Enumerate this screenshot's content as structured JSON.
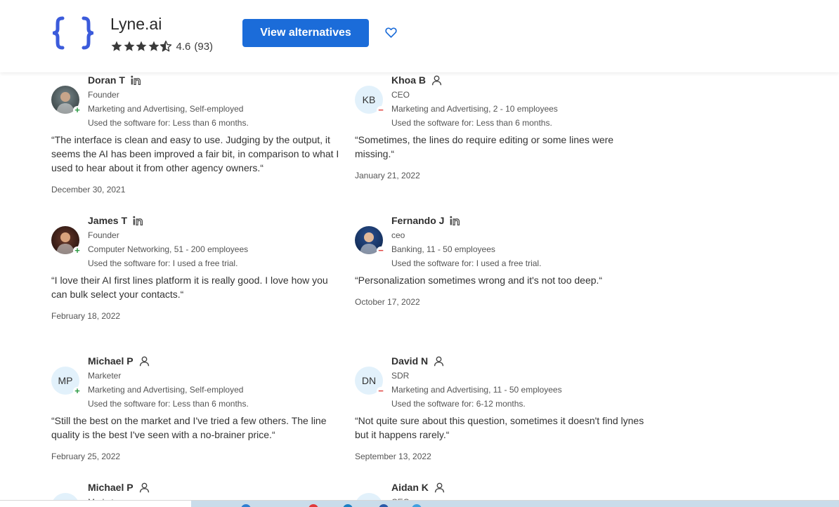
{
  "header": {
    "logo_icon": "curly-braces-logo-icon",
    "logo_color": "#3b5bdb",
    "product_name": "Lyne.ai",
    "rating": {
      "stars": 4.5,
      "score": "4.6",
      "count": "(93)"
    },
    "cta_label": "View alternatives",
    "cta_color": "#1b6cd9",
    "favorite_icon": "heart-icon"
  },
  "reviews": [
    {
      "name": "Doran T",
      "source": "linkedin-icon",
      "role": "Founder",
      "company": "Marketing and Advertising, Self-employed",
      "usage": "Used the software for: Less than 6 months.",
      "avatar": {
        "type": "photo",
        "initials": "",
        "sentiment": "+"
      },
      "quote": "“The interface is clean and easy to use. Judging by the output, it seems the AI has been improved a fair bit, in comparison to what I used to hear about it from other agency owners.“",
      "date": "December 30, 2021"
    },
    {
      "name": "Khoa B",
      "source": "user-icon",
      "role": "CEO",
      "company": "Marketing and Advertising, 2 - 10 employees",
      "usage": "Used the software for: Less than 6 months.",
      "avatar": {
        "type": "initials",
        "initials": "KB",
        "sentiment": "−"
      },
      "quote": "“Sometimes, the lines do require editing or some lines were missing.“",
      "date": "January 21, 2022"
    },
    {
      "name": "James T",
      "source": "linkedin-icon",
      "role": "Founder",
      "company": "Computer Networking, 51 - 200 employees",
      "usage": "Used the software for: I used a free trial.",
      "avatar": {
        "type": "photo",
        "initials": "",
        "sentiment": "+"
      },
      "quote": "“I love their AI first lines platform it is really good. I love how you can bulk select your contacts.“",
      "date": "February 18, 2022"
    },
    {
      "name": "Fernando J",
      "source": "linkedin-icon",
      "role": "ceo",
      "company": "Banking, 11 - 50 employees",
      "usage": "Used the software for: I used a free trial.",
      "avatar": {
        "type": "photo",
        "initials": "",
        "sentiment": "−"
      },
      "quote": "“Personalization sometimes wrong and it's not too deep.“",
      "date": "October 17, 2022"
    },
    {
      "name": "Michael P",
      "source": "user-icon",
      "role": "Marketer",
      "company": "Marketing and Advertising, Self-employed",
      "usage": "Used the software for: Less than 6 months.",
      "avatar": {
        "type": "initials",
        "initials": "MP",
        "sentiment": "+"
      },
      "quote": "“Still the best on the market and I've tried a few others. The line quality is the best I've seen with a no-brainer price.“",
      "date": "February 25, 2022"
    },
    {
      "name": "David N",
      "source": "user-icon",
      "role": "SDR",
      "company": "Marketing and Advertising, 11 - 50 employees",
      "usage": "Used the software for: 6-12 months.",
      "avatar": {
        "type": "initials",
        "initials": "DN",
        "sentiment": "−"
      },
      "quote": "“Not quite sure about this question, sometimes it doesn't find lynes but it happens rarely.“",
      "date": "September 13, 2022"
    },
    {
      "name": "Michael P",
      "source": "user-icon",
      "role": "Market",
      "company": "",
      "usage": "",
      "avatar": {
        "type": "initials",
        "initials": "",
        "sentiment": ""
      },
      "quote": "",
      "date": ""
    },
    {
      "name": "Aidan K",
      "source": "user-icon",
      "role": "CEO",
      "company": "",
      "usage": "",
      "avatar": {
        "type": "initials",
        "initials": "",
        "sentiment": ""
      },
      "quote": "",
      "date": ""
    }
  ]
}
